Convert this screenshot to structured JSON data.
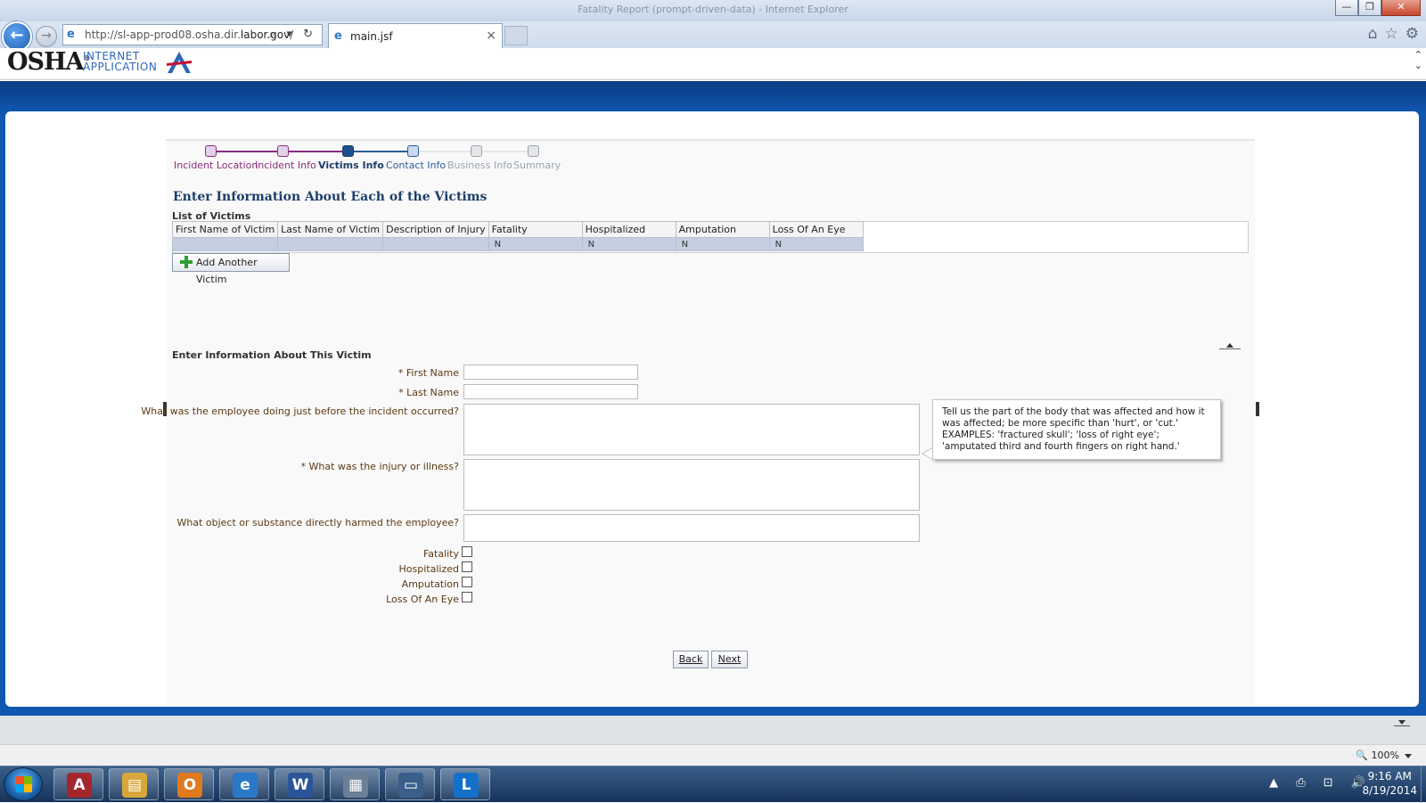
{
  "browser": {
    "window_title": "Fatality Report (prompt-driven-data) - Internet Explorer",
    "url_prefix": "http://sl-app-prod08.osha.dir.",
    "url_domain": "labor.gov",
    "url_suffix": "/",
    "tab_title": "main.jsf",
    "tab_close": "×",
    "back_symbol": "←",
    "forward_symbol": "→",
    "ie_symbol": "e",
    "address_icons": "⌕ ▾ ↻",
    "window_buttons": {
      "minimize": "—",
      "restore": "❐",
      "close": "✕"
    },
    "right_icons": {
      "home": "⌂",
      "favorites": "☆",
      "tools": "⚙"
    },
    "zoom_level": "100%",
    "zoom_icon": "🔍",
    "scroll_up": "⌃",
    "scroll_down": "⌄"
  },
  "app": {
    "logo_main": "OSHA",
    "logo_reg": "®",
    "logo_sub_1": "INTERNET",
    "logo_sub_2": "APPLICATION",
    "accent_color": "#1d3f6b",
    "header_bar_color": "#1057b0"
  },
  "steps": [
    {
      "label": "Incident Location",
      "state": "done"
    },
    {
      "label": "Incident Info",
      "state": "done"
    },
    {
      "label": "Victims Info",
      "state": "active"
    },
    {
      "label": "Contact Info",
      "state": "next"
    },
    {
      "label": "Business Info",
      "state": "disabled"
    },
    {
      "label": "Summary",
      "state": "disabled"
    }
  ],
  "step_colors": {
    "done": "#8a2d7a",
    "done_fill": "#e1d1ec",
    "active": "#1d3f6b",
    "active_fill": "#1d4f8c",
    "next": "#2a5d9a",
    "next_fill": "#c9daf0",
    "disabled": "#9aa3ad",
    "disabled_fill": "#e4e6e9"
  },
  "main": {
    "page_title": "Enter Information About Each of the Victims",
    "list_title": "List of Victims",
    "table_headers": [
      "First Name of Victim",
      "Last Name of Victim",
      "Description of Injury",
      "Fatality",
      "Hospitalized",
      "Amputation",
      "Loss Of An Eye"
    ],
    "table_rows": [
      [
        "",
        "",
        "",
        "N",
        "N",
        "N",
        "N"
      ]
    ],
    "add_button": "Add Another Victim"
  },
  "form": {
    "title": "Enter Information About This Victim",
    "req_mark": "*",
    "first_name_label": "First Name",
    "first_name_value": "",
    "last_name_label": "Last Name",
    "last_name_value": "",
    "doing_label": "What was the employee doing just before the incident occurred?",
    "injury_label": "What was the injury or illness?",
    "object_label": "What object or substance directly harmed the employee?",
    "checkboxes": [
      "Fatality",
      "Hospitalized",
      "Amputation",
      "Loss Of An Eye"
    ],
    "tooltip": "Tell us the part of the body that was affected and how it was affected; be more specific than 'hurt', or 'cut.' EXAMPLES: 'fractured skull'; 'loss of right eye'; 'amputated third and fourth fingers on right hand.'",
    "back_button": "Back",
    "next_button": "Next"
  },
  "taskbar": {
    "apps": [
      {
        "name": "access",
        "glyph": "A",
        "color": "#a4262c"
      },
      {
        "name": "explorer",
        "glyph": "▤",
        "color": "#d9a63a"
      },
      {
        "name": "outlook",
        "glyph": "O",
        "color": "#e07a1f"
      },
      {
        "name": "internet-explorer",
        "glyph": "e",
        "color": "#2b78c8"
      },
      {
        "name": "word",
        "glyph": "W",
        "color": "#2a5699"
      },
      {
        "name": "calculator",
        "glyph": "▦",
        "color": "#6b7f96"
      },
      {
        "name": "files",
        "glyph": "▭",
        "color": "#3a5f8a"
      },
      {
        "name": "lync",
        "glyph": "L",
        "color": "#1570c9"
      }
    ],
    "tray_icons": "▲ ⎙ ⊡ 🔊",
    "time": "9:16 AM",
    "date": "8/19/2014"
  }
}
